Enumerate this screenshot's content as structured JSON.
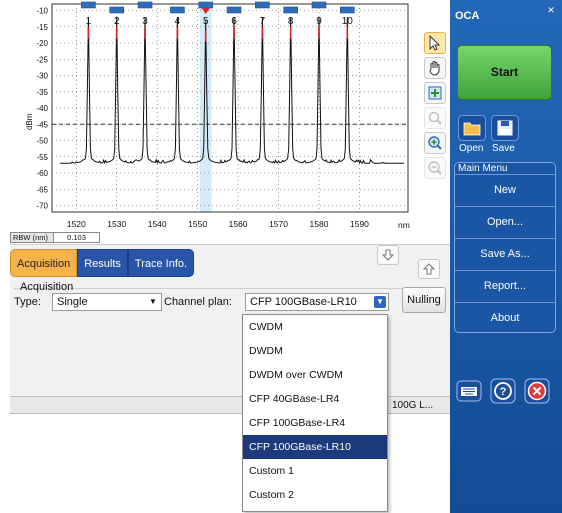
{
  "app": {
    "title": "OCA"
  },
  "plot": {
    "y_label": "dBm",
    "x_unit": "nm",
    "y_ticks": [
      "-10",
      "-15",
      "-20",
      "-25",
      "-30",
      "-35",
      "-40",
      "-45",
      "-50",
      "-55",
      "-60",
      "-65",
      "-70"
    ],
    "x_ticks": [
      "1520",
      "1530",
      "1540",
      "1550",
      "1560",
      "1570",
      "1580",
      "1590"
    ],
    "channels": [
      "1",
      "2",
      "3",
      "4",
      "5",
      "6",
      "7",
      "8",
      "9",
      "10"
    ],
    "rbw_label": "RBW (nm)",
    "rbw_value": "0.103",
    "colors": {
      "trace": "#111111",
      "peak_tip": "#e02020",
      "marker": "#2f6db8",
      "grid": "#555555",
      "highlight": "#d4ecf7"
    }
  },
  "chart_data": {
    "type": "line",
    "title": "",
    "xlabel": "nm",
    "ylabel": "dBm",
    "xlim": [
      1514,
      1602
    ],
    "ylim": [
      -72,
      -8
    ],
    "grid": true,
    "threshold": -45,
    "series": [
      {
        "peaks_x": [
          1523,
          1530,
          1537,
          1545,
          1552,
          1559,
          1566,
          1573,
          1580,
          1587
        ],
        "peaks_y": [
          -15,
          -15,
          -15,
          -15,
          -16,
          -15,
          -15,
          -15,
          -15,
          -15
        ],
        "baseline_y": -57
      }
    ]
  },
  "toolbar": {
    "icons": [
      "cursor-icon",
      "hand-pan-icon",
      "zoom-fit-icon",
      "zoom-search-icon",
      "zoom-in-icon",
      "zoom-out-icon"
    ]
  },
  "tabs": [
    {
      "label": "Acquisition",
      "active": true
    },
    {
      "label": "Results",
      "active": false
    },
    {
      "label": "Trace Info.",
      "active": false
    }
  ],
  "acquisition": {
    "group_label": "Acquisition",
    "type_label": "Type:",
    "type_value": "Single",
    "plan_label": "Channel plan:",
    "plan_value": "CFP 100GBase-LR10",
    "nulling_label": "Nulling",
    "plan_options": [
      "CWDM",
      "DWDM",
      "DWDM over CWDM",
      "CFP 40GBase-LR4",
      "CFP 100GBase-LR4",
      "CFP 100GBase-LR10",
      "Custom 1",
      "Custom 2"
    ],
    "selected_index": 5
  },
  "status": {
    "text": "100G L..."
  },
  "side": {
    "start_label": "Start",
    "open_label": "Open",
    "save_label": "Save",
    "menu_title": "Main Menu",
    "menu_items": [
      "New",
      "Open...",
      "Save As...",
      "Report...",
      "About"
    ],
    "accent": "#2368b9",
    "start_color": "#4fb846"
  }
}
